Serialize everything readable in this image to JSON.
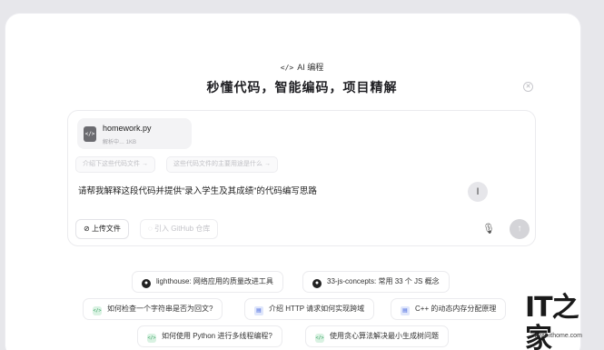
{
  "header": {
    "badge": "AI 编程",
    "title": "秒懂代码，智能编码，项目精解",
    "close_glyph": "✕"
  },
  "attachment": {
    "filename": "homework.py",
    "status": "解析中…   1KB"
  },
  "suggestions": [
    "介绍下这些代码文件 →",
    "这些代码文件的主要用途是什么 →"
  ],
  "prompt_text": "请帮我解释这段代码并提供“录入学生及其成绩”的代码编写思路",
  "buttons": {
    "upload": "上传文件",
    "github": "引入 GitHub 仓库",
    "send_glyph": "↑",
    "mic_glyph": "🎙"
  },
  "examples": [
    {
      "icon": "github-icon",
      "label": "lighthouse: 网络应用的质量改进工具"
    },
    {
      "icon": "github-icon",
      "label": "33-js-concepts: 常用 33 个 JS 概念"
    },
    {
      "icon": "code-icon",
      "label": "如何检查一个字符串是否为回文?"
    },
    {
      "icon": "doc-icon",
      "label": "介绍 HTTP 请求如何实现跨域"
    },
    {
      "icon": "doc-icon",
      "label": "C++ 的动态内存分配原理"
    },
    {
      "icon": "code-icon",
      "label": "如何使用 Python 进行多线程编程?"
    },
    {
      "icon": "code-icon",
      "label": "使用贪心算法解决最小生成树问题"
    }
  ],
  "watermark": {
    "logo": "IT之家",
    "url": "www.ithome.com"
  }
}
